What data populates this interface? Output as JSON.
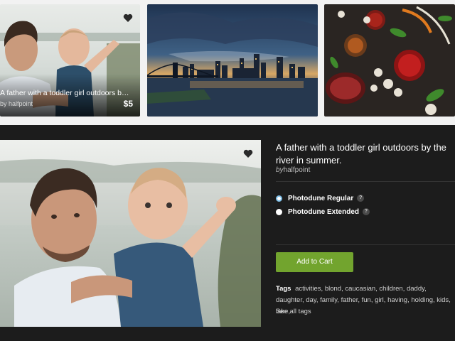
{
  "thumbnails": [
    {
      "caption": "A father with a toddler girl outdoors by the river in s...",
      "sub": "by halfpoint",
      "price": "$5",
      "icon": "heart-icon"
    },
    {
      "subject": "city skyline at dusk"
    },
    {
      "subject": "food ingredients top view"
    }
  ],
  "detail": {
    "title": "A father with a toddler girl outdoors by the river in summer.",
    "by_label": "by",
    "author": "halfpoint",
    "licenses": [
      {
        "label": "Photodune Regular",
        "selected": true,
        "help": "?"
      },
      {
        "label": "Photodune Extended",
        "selected": false,
        "help": "?"
      }
    ],
    "add_to_cart": "Add to Cart",
    "tags_label": "Tags",
    "tags": [
      "activities",
      "blond",
      "caucasian",
      "children",
      "daddy",
      "daughter",
      "day",
      "family",
      "father",
      "fun",
      "girl",
      "having",
      "holding",
      "kids",
      "lake"
    ],
    "see_all": "See all tags"
  },
  "colors": {
    "panel_bg": "#1c1c1c",
    "strip_bg": "#f2f2f2",
    "cart_green": "#72a42e",
    "radio_accent": "#7fc0e9"
  }
}
